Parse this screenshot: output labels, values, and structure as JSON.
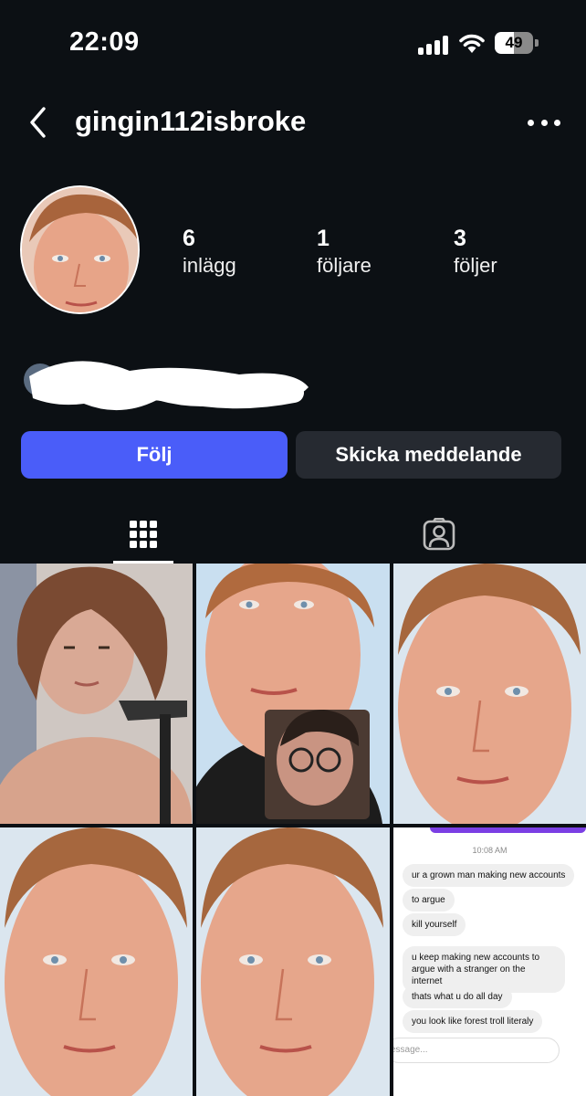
{
  "status_bar": {
    "time": "22:09",
    "battery_level": "49",
    "battery_fraction": 0.49
  },
  "header": {
    "username": "gingin112isbroke",
    "back_icon": "chevron-left-icon",
    "more_icon": "ellipsis-icon"
  },
  "profile": {
    "stats": [
      {
        "value": "6",
        "label": "inlägg"
      },
      {
        "value": "1",
        "label": "följare"
      },
      {
        "value": "3",
        "label": "följer"
      }
    ]
  },
  "actions": {
    "follow_label": "Följ",
    "message_label": "Skicka meddelande"
  },
  "tabs": [
    {
      "icon": "grid-icon",
      "active": true
    },
    {
      "icon": "tagged-person-icon",
      "active": false
    }
  ],
  "posts": {
    "chat_screenshot": {
      "time": "10:08 AM",
      "messages": [
        "ur a grown man making new accounts",
        "to argue",
        "kill yourself",
        "u keep making new accounts to argue with a stranger on the internet",
        "thats what u do all day",
        "you look like forest troll literaly"
      ],
      "input_placeholder": "essage..."
    }
  },
  "colors": {
    "background": "#0c1014",
    "follow_button": "#4a5df9",
    "message_button": "#262a31"
  }
}
